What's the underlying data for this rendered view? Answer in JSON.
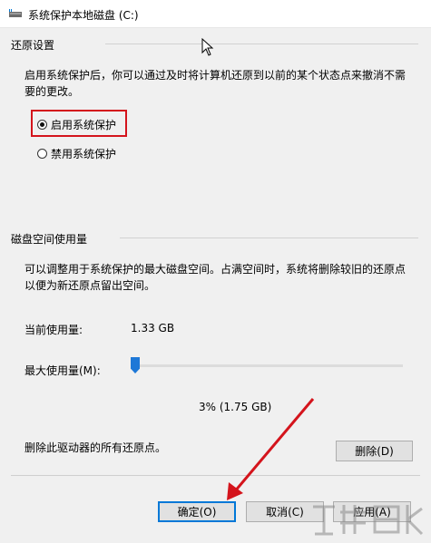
{
  "window": {
    "title": "系统保护本地磁盘 (C:)"
  },
  "restore": {
    "group_label": "还原设置",
    "description": "启用系统保护后，你可以通过及时将计算机还原到以前的某个状态点来撤消不需要的更改。",
    "options": [
      {
        "label": "启用系统保护",
        "selected": true
      },
      {
        "label": "禁用系统保护",
        "selected": false
      }
    ]
  },
  "disk": {
    "group_label": "磁盘空间使用量",
    "description": "可以调整用于系统保护的最大磁盘空间。占满空间时，系统将删除较旧的还原点以便为新还原点留出空间。",
    "current_usage_label": "当前使用量:",
    "current_usage_value": "1.33 GB",
    "max_usage_label": "最大使用量(M):",
    "max_usage_percent": 3,
    "max_usage_text": "3% (1.75 GB)",
    "delete_text": "删除此驱动器的所有还原点。",
    "delete_button": "删除(D)"
  },
  "buttons": {
    "ok": "确定(O)",
    "cancel": "取消(C)",
    "apply": "应用(A)"
  },
  "colors": {
    "highlight_box": "#d4141c",
    "slider_thumb": "#1e78d7",
    "default_button_border": "#0078d7"
  }
}
